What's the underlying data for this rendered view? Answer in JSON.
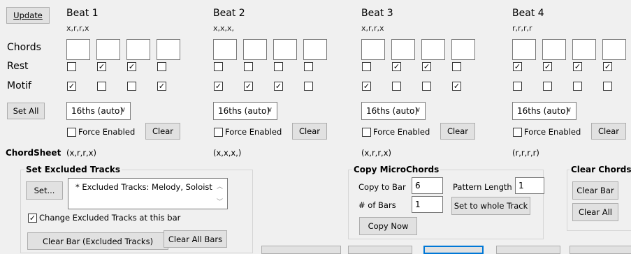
{
  "update_label": "Update",
  "set_all_label": "Set All",
  "rows": {
    "chords": "Chords",
    "rest": "Rest",
    "motif": "Motif"
  },
  "beats": [
    {
      "title": "Beat 1",
      "pattern": "x,r,r,x",
      "rest": [
        false,
        true,
        true,
        false
      ],
      "motif": [
        true,
        false,
        false,
        true
      ],
      "subdivision": "16ths (auto)",
      "force_label": "Force Enabled",
      "force": false,
      "clear_label": "Clear",
      "chordsheet": "(x,r,r,x)"
    },
    {
      "title": "Beat 2",
      "pattern": "x,x,x,",
      "rest": [
        false,
        false,
        false,
        false
      ],
      "motif": [
        true,
        true,
        true,
        false
      ],
      "subdivision": "16ths (auto)",
      "force_label": "Force Enabled",
      "force": false,
      "clear_label": "Clear",
      "chordsheet": "(x,x,x,)"
    },
    {
      "title": "Beat 3",
      "pattern": "x,r,r,x",
      "rest": [
        false,
        true,
        true,
        false
      ],
      "motif": [
        true,
        false,
        false,
        true
      ],
      "subdivision": "16ths (auto)",
      "force_label": "Force Enabled",
      "force": false,
      "clear_label": "Clear",
      "chordsheet": "(x,r,r,x)"
    },
    {
      "title": "Beat 4",
      "pattern": "r,r,r,r",
      "rest": [
        true,
        true,
        true,
        true
      ],
      "motif": [
        false,
        false,
        false,
        false
      ],
      "subdivision": "16ths (auto)",
      "force_label": "Force Enabled",
      "force": false,
      "clear_label": "Clear",
      "chordsheet": "(r,r,r,r)"
    }
  ],
  "chordsheet_label": "ChordSheet",
  "excluded": {
    "title": "Set Excluded Tracks",
    "set_label": "Set...",
    "text": "* Excluded Tracks: Melody, Soloist",
    "change_label": "Change Excluded Tracks at this bar",
    "change_checked": true,
    "clear_bar_label": "Clear Bar  (Excluded Tracks)",
    "clear_all_bars_label": "Clear All Bars"
  },
  "micro": {
    "title": "Copy MicroChords",
    "copy_to_bar_label": "Copy to Bar",
    "copy_to_bar_value": "6",
    "pattern_length_label": "Pattern Length",
    "pattern_length_value": "1",
    "num_bars_label": "# of Bars",
    "num_bars_value": "1",
    "whole_track_label": "Set to whole Track",
    "copy_now_label": "Copy Now"
  },
  "clear_chords": {
    "title": "Clear Chords",
    "clear_bar_label": "Clear Bar",
    "clear_all_label": "Clear All"
  },
  "colors": {
    "window_bg": "#f0f0f0",
    "button_bg": "#e1e1e1",
    "focus_blue": "#0078d7"
  }
}
